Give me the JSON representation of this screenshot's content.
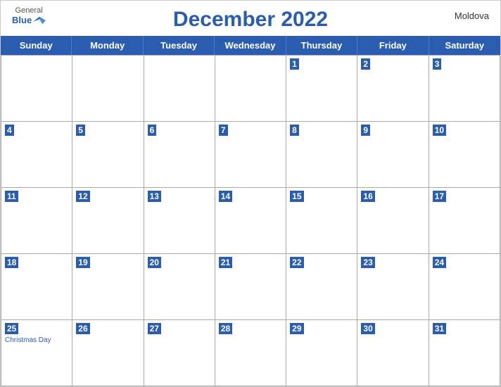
{
  "header": {
    "title": "December 2022",
    "country": "Moldova",
    "logo_general": "General",
    "logo_blue": "Blue"
  },
  "days_of_week": [
    "Sunday",
    "Monday",
    "Tuesday",
    "Wednesday",
    "Thursday",
    "Friday",
    "Saturday"
  ],
  "weeks": [
    [
      {
        "day": "",
        "empty": true
      },
      {
        "day": "",
        "empty": true
      },
      {
        "day": "",
        "empty": true
      },
      {
        "day": "",
        "empty": true
      },
      {
        "day": "1"
      },
      {
        "day": "2"
      },
      {
        "day": "3"
      }
    ],
    [
      {
        "day": "4"
      },
      {
        "day": "5"
      },
      {
        "day": "6"
      },
      {
        "day": "7"
      },
      {
        "day": "8"
      },
      {
        "day": "9"
      },
      {
        "day": "10"
      }
    ],
    [
      {
        "day": "11"
      },
      {
        "day": "12"
      },
      {
        "day": "13"
      },
      {
        "day": "14"
      },
      {
        "day": "15"
      },
      {
        "day": "16"
      },
      {
        "day": "17"
      }
    ],
    [
      {
        "day": "18"
      },
      {
        "day": "19"
      },
      {
        "day": "20"
      },
      {
        "day": "21"
      },
      {
        "day": "22"
      },
      {
        "day": "23"
      },
      {
        "day": "24"
      }
    ],
    [
      {
        "day": "25",
        "event": "Christmas Day"
      },
      {
        "day": "26"
      },
      {
        "day": "27"
      },
      {
        "day": "28"
      },
      {
        "day": "29"
      },
      {
        "day": "30"
      },
      {
        "day": "31"
      }
    ]
  ]
}
